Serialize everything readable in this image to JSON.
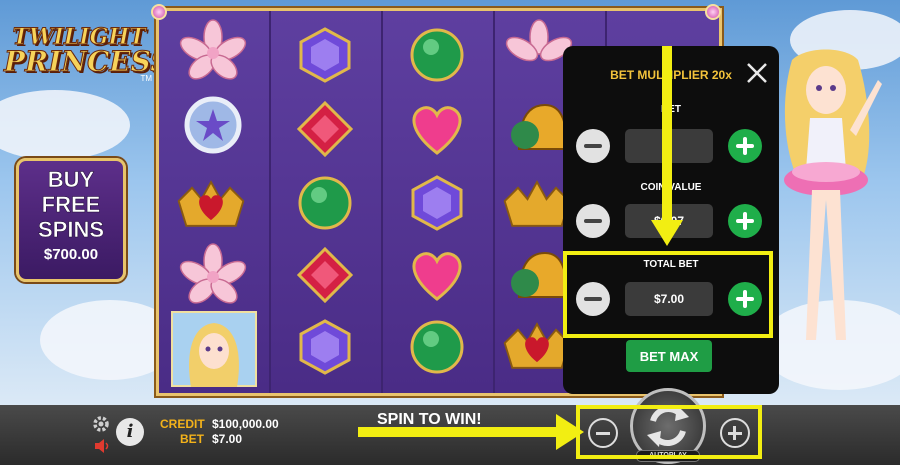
{
  "game": {
    "logo_line1": "TWILIGHT",
    "logo_line2": "PRINCESS",
    "logo_tm": "TM"
  },
  "buy_feature": {
    "line1": "BUY",
    "line2": "FREE",
    "line3": "SPINS",
    "price": "$700.00"
  },
  "reels": {
    "columns": [
      [
        "lotus-flower",
        "star-mirror",
        "heart-crown",
        "lotus-flower",
        "princess-portrait"
      ],
      [
        "purple-gem",
        "red-gem",
        "green-gem",
        "red-gem",
        "purple-gem"
      ],
      [
        "green-gem",
        "pink-heart",
        "purple-gem",
        "pink-heart",
        "green-gem"
      ],
      [
        "lotus-flower",
        "golden-bell",
        "heart-crown",
        "golden-bell",
        "heart-crown"
      ]
    ]
  },
  "bet_panel": {
    "multiplier_label": "BET MULTIPLIER 20x",
    "bet_label": "BET",
    "coin_value_label": "COIN VALUE",
    "bet_value": "",
    "coin_value": "$0.07",
    "total_bet_label": "TOTAL BET",
    "total_bet_value": "$7.00",
    "bet_max_label": "BET MAX"
  },
  "bottom_bar": {
    "credit_label": "CREDIT",
    "credit_value": "$100,000.00",
    "bet_label": "BET",
    "bet_value": "$7.00",
    "spin_to_win": "SPIN TO WIN!",
    "autoplay_label": "AUTOPLAY",
    "info_glyph": "i"
  },
  "colors": {
    "highlight": "#f2ee12",
    "accent_gold": "#f3c33b",
    "plus_green": "#1fae4a"
  }
}
